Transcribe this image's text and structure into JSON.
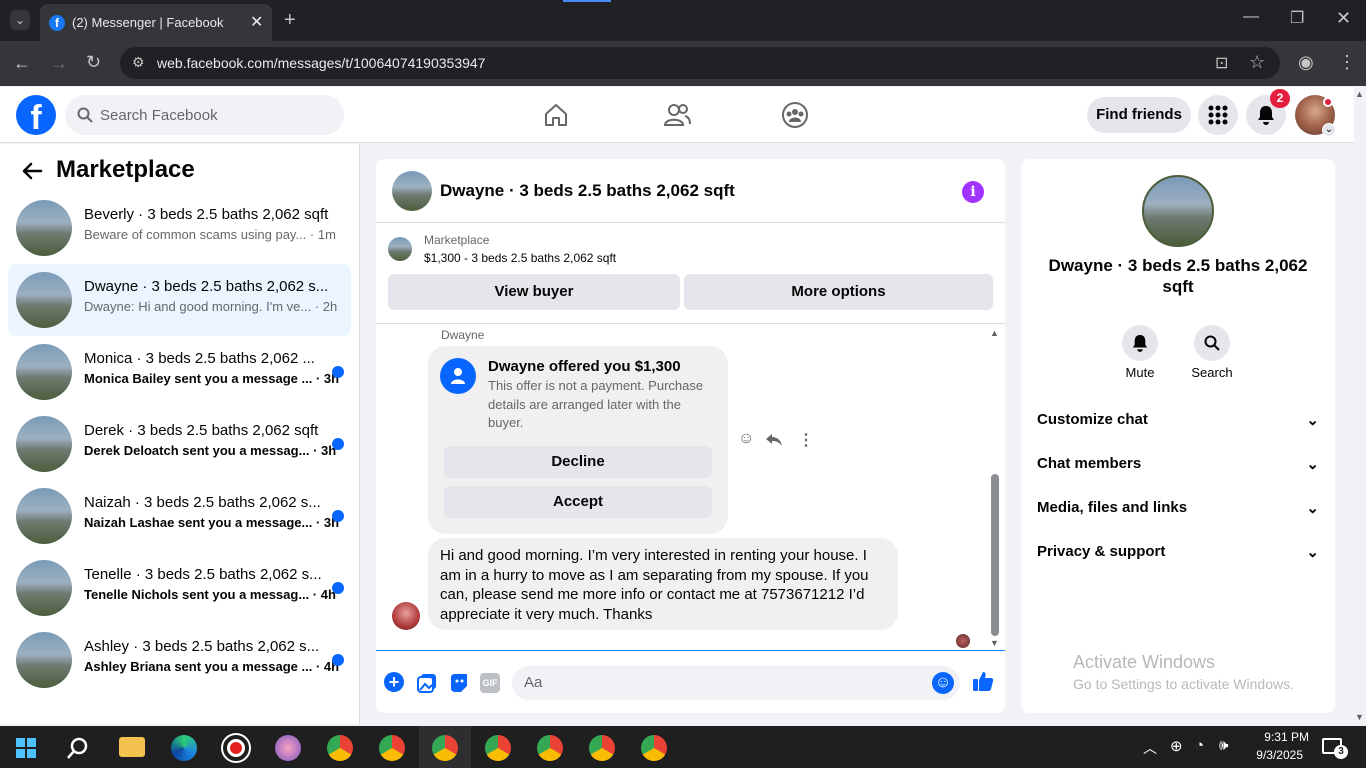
{
  "browser": {
    "tab_title": "(2) Messenger | Facebook",
    "url": "web.facebook.com/messages/t/10064074190353947"
  },
  "header": {
    "search_placeholder": "Search Facebook",
    "find_friends": "Find friends",
    "notification_count": "2"
  },
  "sidebar": {
    "title": "Marketplace",
    "conversations": [
      {
        "name": "Beverly · 3 beds 2.5 baths 2,062 sqft",
        "preview": "Beware of common scams using pay...",
        "time": "· 1m",
        "unread": false
      },
      {
        "name": "Dwayne · 3 beds 2.5 baths 2,062 s...",
        "preview": "Dwayne: Hi and good morning. I'm ve...",
        "time": "· 2h",
        "unread": false
      },
      {
        "name": "Monica · 3 beds 2.5 baths 2,062 ...",
        "preview": "Monica Bailey sent you a message ...",
        "time": "· 3h",
        "unread": true
      },
      {
        "name": "Derek · 3 beds 2.5 baths 2,062 sqft",
        "preview": "Derek Deloatch sent you a messag...",
        "time": "· 3h",
        "unread": true
      },
      {
        "name": "Naizah · 3 beds 2.5 baths 2,062 s...",
        "preview": "Naizah Lashae sent you a message...",
        "time": "· 3h",
        "unread": true
      },
      {
        "name": "Tenelle · 3 beds 2.5 baths 2,062 s...",
        "preview": "Tenelle Nichols sent you a messag...",
        "time": "· 4h",
        "unread": true
      },
      {
        "name": "Ashley · 3 beds 2.5 baths 2,062 s...",
        "preview": "Ashley Briana sent you a message ...",
        "time": "· 4h",
        "unread": true
      }
    ]
  },
  "chat": {
    "title": "Dwayne · 3 beds 2.5 baths 2,062 sqft",
    "marketplace_label": "Marketplace",
    "listing": "$1,300 - 3 beds 2.5 baths 2,062 sqft",
    "view_buyer": "View buyer",
    "more_options": "More options",
    "sender": "Dwayne",
    "offer_title": "Dwayne offered you $1,300",
    "offer_text": "This offer is not a payment. Purchase details are arranged later with the buyer.",
    "decline": "Decline",
    "accept": "Accept",
    "message": "Hi and good morning. I’m very interested in renting your house. I am in a hurry to move as I am separating from my spouse. If you can, please send me more info or contact me at 7573671212 I’d appreciate it very much. Thanks",
    "composer_placeholder": "Aa",
    "gif_label": "GIF"
  },
  "details": {
    "title": "Dwayne · 3 beds 2.5 baths 2,062 sqft",
    "mute": "Mute",
    "search": "Search",
    "sections": [
      "Customize chat",
      "Chat members",
      "Media, files and links",
      "Privacy & support"
    ]
  },
  "watermark": {
    "line1": "Activate Windows",
    "line2": "Go to Settings to activate Windows."
  },
  "taskbar": {
    "time": "9:31 PM",
    "date": "9/3/2025",
    "notif": "3"
  }
}
